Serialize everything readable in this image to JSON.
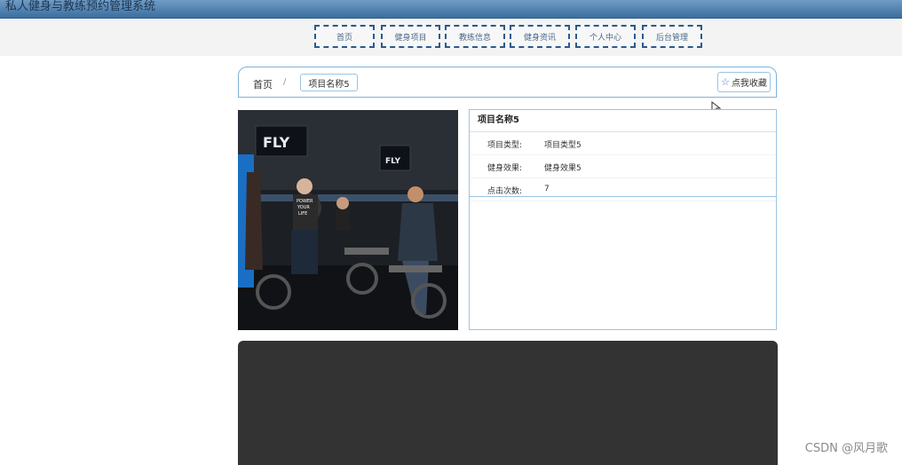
{
  "app": {
    "title": "私人健身与教练预约管理系统"
  },
  "nav": {
    "items": [
      {
        "label": "首页"
      },
      {
        "label": "健身项目"
      },
      {
        "label": "教练信息"
      },
      {
        "label": "健身资讯"
      },
      {
        "label": "个人中心"
      },
      {
        "label": "后台管理"
      }
    ]
  },
  "breadcrumb": {
    "home": "首页",
    "separator": "/",
    "current": "项目名称5"
  },
  "favorite": {
    "label": "点我收藏",
    "icon": "star-icon"
  },
  "detail": {
    "title": "项目名称5",
    "fields": [
      {
        "key": "项目类型:",
        "value": "项目类型5"
      },
      {
        "key": "健身效果:",
        "value": "健身效果5"
      },
      {
        "key": "点击次数:",
        "value": "7"
      }
    ]
  },
  "photo": {
    "logo_text": "FLY",
    "shirt_text_1": "POWER",
    "shirt_text_2": "YOUR",
    "shirt_text_3": "LIFE"
  },
  "watermark": "CSDN @风月歌",
  "colors": {
    "accent": "#2a5a8e",
    "border": "#9cc3e0",
    "header": "#4a7fae",
    "video": "#333333"
  }
}
